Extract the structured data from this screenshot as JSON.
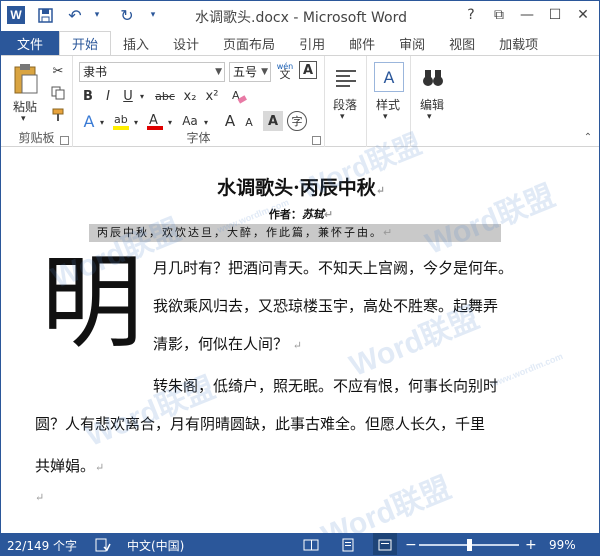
{
  "app": {
    "logo_letter": "W",
    "title": "水调歌头.docx - Microsoft Word"
  },
  "qat": {
    "undo": "↶",
    "redo": "↻"
  },
  "window_controls": {
    "help": "?",
    "restore_ribbon": "⧉",
    "minimize": "—",
    "maximize": "☐",
    "close": "✕"
  },
  "tabs": {
    "file": "文件",
    "items": [
      "开始",
      "插入",
      "设计",
      "页面布局",
      "引用",
      "邮件",
      "审阅",
      "视图",
      "加载项"
    ],
    "active": "开始"
  },
  "ribbon": {
    "clipboard": {
      "paste": "粘贴",
      "label": "剪贴板"
    },
    "font": {
      "font_name": "隶书",
      "font_size": "五号",
      "wen": "wén",
      "bold": "B",
      "italic": "I",
      "underline": "U",
      "strike": "abc",
      "sub": "x₂",
      "sup": "x²",
      "aa": "Aa",
      "grow": "A",
      "shrink": "A",
      "label": "字体"
    },
    "paragraph": {
      "label": "段落"
    },
    "styles": {
      "label": "样式"
    },
    "editing": {
      "label": "编辑"
    }
  },
  "document": {
    "title": "水调歌头·丙辰中秋",
    "author_label": "作者：",
    "author_name": "苏轼",
    "preface": "丙辰中秋，欢饮达旦，大醉，作此篇，兼怀子由。",
    "dropcap": "明",
    "lines": [
      "月几时有？把酒问青天。不知天上宫阙，今夕是何年。",
      "我欲乘风归去，又恐琼楼玉宇，高处不胜寒。起舞弄",
      "清影，何似在人间？",
      "转朱阁，低绮户，照无眠。不应有恨，何事长向别时",
      "圆？人有悲欢离合，月有阴晴圆缺，此事古难全。但愿人长久，千里",
      "共婵娟。"
    ],
    "para_mark": "↵",
    "watermark": "Word联盟",
    "watermark_url": "www.wordlm.com"
  },
  "status": {
    "words": "22/149 个字",
    "language": "中文(中国)",
    "zoom_minus": "−",
    "zoom_plus": "+",
    "zoom": "99%",
    "zoom_value": 0.99
  },
  "colors": {
    "accent": "#2b579a",
    "highlight": "#c9c9c9"
  }
}
